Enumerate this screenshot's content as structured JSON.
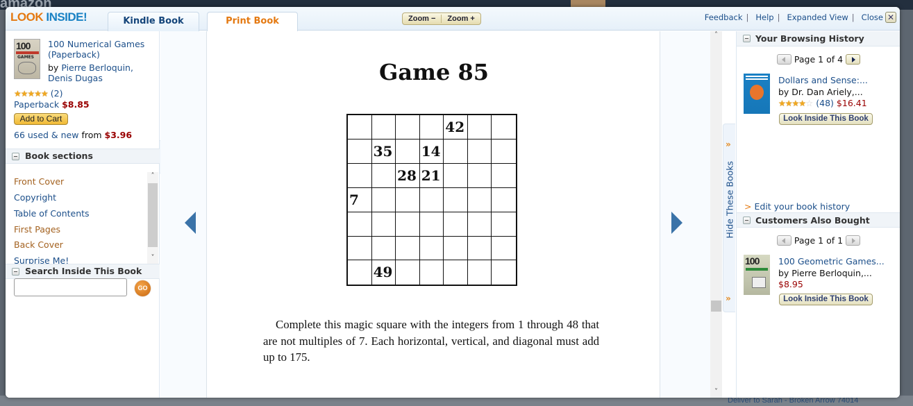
{
  "backdrop": {
    "site_logo": "amazon",
    "deliver_text": "Deliver to Sarah - Broken Arrow 74014"
  },
  "header": {
    "logo_look": "LOOK",
    "logo_inside": "INSIDE!",
    "tabs": [
      {
        "label": "Kindle Book",
        "active": false
      },
      {
        "label": "Print Book",
        "active": true
      }
    ],
    "zoom_out": "Zoom −",
    "zoom_in": "Zoom +",
    "links": [
      {
        "label": "Feedback"
      },
      {
        "label": "Help"
      },
      {
        "label": "Expanded View"
      },
      {
        "label": "Close"
      }
    ],
    "close_icon": "✕"
  },
  "book": {
    "cover_text": "100",
    "cover_subtitle": "GAMES",
    "title": "100 Numerical Games (Paperback)",
    "by_prefix": "by ",
    "authors": [
      "Pierre Berloquin,",
      "Denis Dugas"
    ],
    "rating": 5,
    "stars": "★★★★★",
    "review_count": "(2)",
    "format": "Paperback",
    "price": "$8.85",
    "add_to_cart": "Add to Cart",
    "used_new": "66 used & new",
    "from_label": " from ",
    "used_price": "$3.96"
  },
  "book_sections": {
    "heading": "Book sections",
    "items": [
      {
        "label": "Front Cover",
        "color": "orange"
      },
      {
        "label": "Copyright",
        "color": "blue"
      },
      {
        "label": "Table of Contents",
        "color": "blue"
      },
      {
        "label": "First Pages",
        "color": "orange"
      },
      {
        "label": "Back Cover",
        "color": "orange"
      },
      {
        "label": "Surprise Me!",
        "color": "blue"
      }
    ],
    "scroll_up": "˄",
    "scroll_down": "˅"
  },
  "search_inside": {
    "heading": "Search Inside This Book",
    "value": "",
    "placeholder": "",
    "go_label": "GO"
  },
  "reader": {
    "collapse_left_icon": "«",
    "game_title": "Game 85",
    "grid": [
      [
        "",
        "",
        "",
        "",
        "42",
        "",
        ""
      ],
      [
        "",
        "35",
        "",
        "14",
        "",
        "",
        ""
      ],
      [
        "",
        "",
        "28",
        "21",
        "",
        "",
        ""
      ],
      [
        "7",
        "",
        "",
        "",
        "",
        "",
        ""
      ],
      [
        "",
        "",
        "",
        "",
        "",
        "",
        ""
      ],
      [
        "",
        "",
        "",
        "",
        "",
        "",
        ""
      ],
      [
        "",
        "49",
        "",
        "",
        "",
        "",
        ""
      ]
    ],
    "instructions": "Complete this magic square with the integers from 1 through 48 that are not multiples of 7. Each horizontal, vertical, and diagonal must add up to 175.",
    "scroll_up": "˄",
    "scroll_down": "˅"
  },
  "hide_books": {
    "label": "Hide These Books",
    "chevron": "»"
  },
  "browsing_history": {
    "heading": "Your Browsing History",
    "pager": "Page 1 of 4",
    "book": {
      "title": "Dollars and Sense:...",
      "by": "by Dr. Dan Ariely,...",
      "stars": "★★★★",
      "star_empty": "☆",
      "rating": 4,
      "review_count": "(48)",
      "price": "$16.41",
      "look_inside": "Look Inside This Book"
    },
    "edit_prefix": ">",
    "edit_link": "Edit your book history"
  },
  "also_bought": {
    "heading": "Customers Also Bought",
    "pager": "Page 1 of 1",
    "book": {
      "cover_text": "100",
      "title": "100 Geometric Games...",
      "by": "by Pierre Berloquin,...",
      "price": "$8.95",
      "look_inside": "Look Inside This Book"
    }
  }
}
